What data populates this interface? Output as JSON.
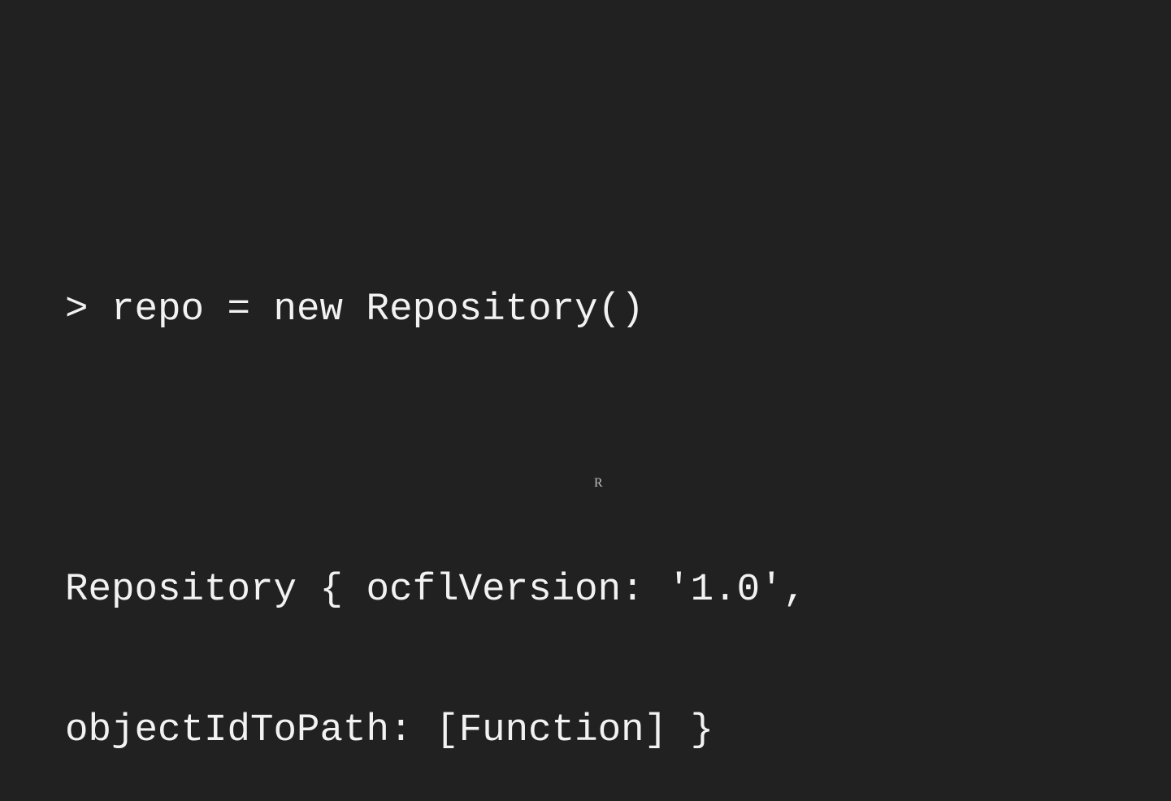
{
  "code": {
    "lines": [
      "> repo = new Repository()",
      "",
      "Repository { ocflVersion: '1.0',",
      "objectIdToPath: [Function] }"
    ]
  },
  "marker": "R",
  "colors": {
    "background": "#212121",
    "text": "#f2f2f2"
  }
}
